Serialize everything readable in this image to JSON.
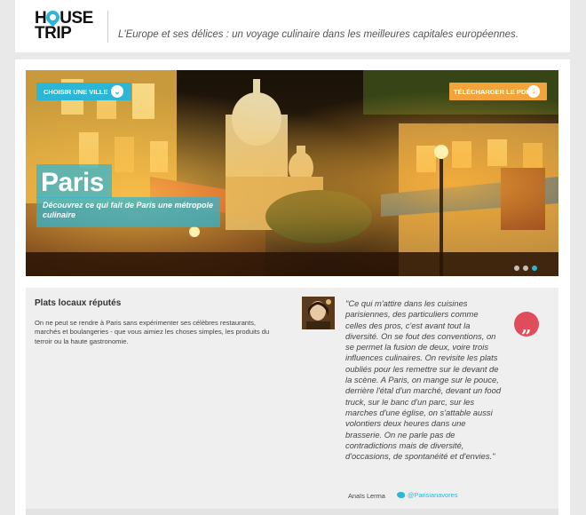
{
  "header": {
    "logo_line1": "H",
    "logo_line1_rest": "USE",
    "logo_line2": "TRIP",
    "tagline": "L'Europe et ses délices : un voyage culinaire dans les meilleures capitales européennes."
  },
  "hero": {
    "choose_city": "CHOISIR UNE VILLE",
    "download_pdf": "TÉLÉCHARGER LE PDF",
    "city": "Paris",
    "city_subtitle": "Découvrez ce qui fait de Paris une métropole culinaire",
    "slides_total": 3,
    "slide_active": 3
  },
  "section": {
    "title": "Plats locaux réputés",
    "text": "On ne peut se rendre à Paris sans expérimenter ses célèbres restaurants, marchés et boulangeries - que vous aimiez les choses simples, les produits du terroir ou la haute gastronomie.",
    "quote": "\"Ce qui m'attire dans les cuisines parisiennes, des particuliers comme celles des pros, c'est avant tout la diversité. On se fout des conventions, on se permet la fusion de deux, voire trois influences culinaires. On revisite les plats oubliés pour les remettre sur le devant de la scène. A Paris, on mange sur le pouce, derrière l'étal d'un marché, devant un food truck, sur le banc d'un parc, sur les marches d'une église, on s'attable aussi volontiers deux heures dans une brasserie. On ne parle pas de contradictions mais de diversité, d'occasions, de spontanéité et d'envies.\"",
    "author": "Anaïs Lerma",
    "twitter": "@Parisianavores"
  },
  "colors": {
    "accent": "#2cb6d6",
    "pdf": "#f2a33a",
    "quote_icon": "#e14c5a"
  }
}
